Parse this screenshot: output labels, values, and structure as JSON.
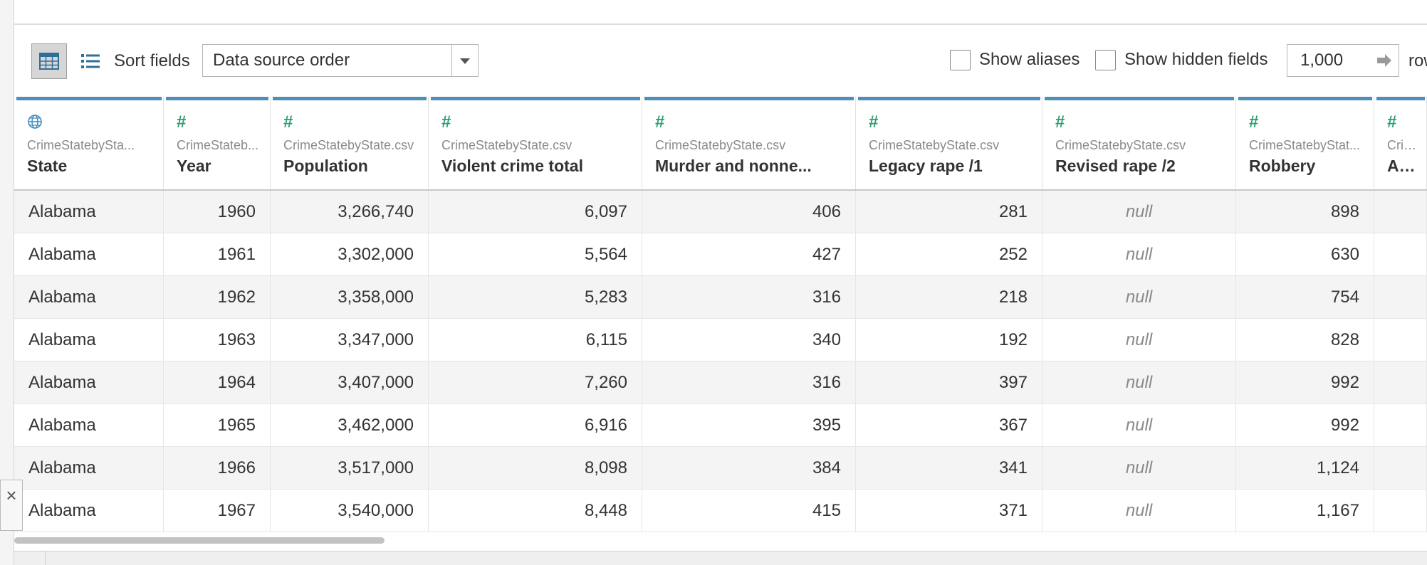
{
  "toolbar": {
    "grid_view_icon": "grid-view-icon",
    "list_view_icon": "list-view-icon",
    "sort_label": "Sort fields",
    "sort_value": "Data source order",
    "show_aliases_label": "Show aliases",
    "show_aliases_checked": false,
    "show_hidden_label": "Show hidden fields",
    "show_hidden_checked": false,
    "rows_value": "1,000",
    "rows_label": "rows"
  },
  "colors": {
    "accent_bar": "#4f8fb7",
    "type_icon": "#2c9f6f",
    "zebra": "#f4f4f4"
  },
  "columns": [
    {
      "type_icon": "globe-icon",
      "source": "CrimeStatebySta...",
      "name": "State"
    },
    {
      "type_icon": "#",
      "source": "CrimeStateb...",
      "name": "Year"
    },
    {
      "type_icon": "#",
      "source": "CrimeStatebyState.csv",
      "name": "Population"
    },
    {
      "type_icon": "#",
      "source": "CrimeStatebyState.csv",
      "name": "Violent crime total"
    },
    {
      "type_icon": "#",
      "source": "CrimeStatebyState.csv",
      "name": "Murder and nonne..."
    },
    {
      "type_icon": "#",
      "source": "CrimeStatebyState.csv",
      "name": "Legacy rape /1"
    },
    {
      "type_icon": "#",
      "source": "CrimeStatebyState.csv",
      "name": "Revised rape /2"
    },
    {
      "type_icon": "#",
      "source": "CrimeStatebyStat...",
      "name": "Robbery"
    },
    {
      "type_icon": "#",
      "source": "CrimeSt",
      "name": "Aggra"
    }
  ],
  "rows": [
    [
      "Alabama",
      "1960",
      "3,266,740",
      "6,097",
      "406",
      "281",
      "null",
      "898",
      ""
    ],
    [
      "Alabama",
      "1961",
      "3,302,000",
      "5,564",
      "427",
      "252",
      "null",
      "630",
      ""
    ],
    [
      "Alabama",
      "1962",
      "3,358,000",
      "5,283",
      "316",
      "218",
      "null",
      "754",
      ""
    ],
    [
      "Alabama",
      "1963",
      "3,347,000",
      "6,115",
      "340",
      "192",
      "null",
      "828",
      ""
    ],
    [
      "Alabama",
      "1964",
      "3,407,000",
      "7,260",
      "316",
      "397",
      "null",
      "992",
      ""
    ],
    [
      "Alabama",
      "1965",
      "3,462,000",
      "6,916",
      "395",
      "367",
      "null",
      "992",
      ""
    ],
    [
      "Alabama",
      "1966",
      "3,517,000",
      "8,098",
      "384",
      "341",
      "null",
      "1,124",
      ""
    ],
    [
      "Alabama",
      "1967",
      "3,540,000",
      "8,448",
      "415",
      "371",
      "null",
      "1,167",
      ""
    ]
  ],
  "close_icon": "close-icon"
}
